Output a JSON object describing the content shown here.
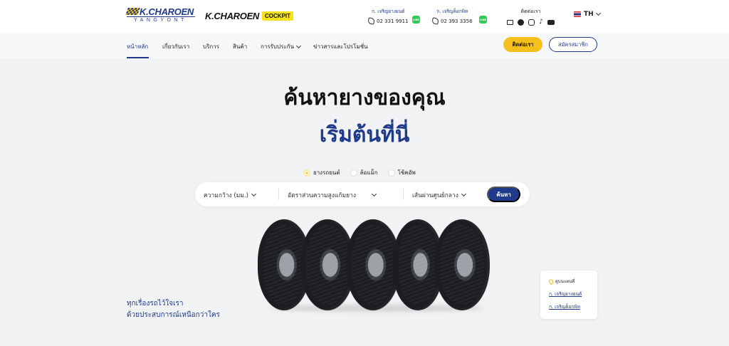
{
  "brand": {
    "logo_main": "K.CHAROEN",
    "logo_sub": "YANGYONT",
    "logo_second": "K.CHAROEN",
    "logo_second_badge": "COCKPIT"
  },
  "contacts": [
    {
      "label": "ก. เจริญยางยนต์",
      "phone": "02 331 9911"
    },
    {
      "label": "ก. เจริญค็อกพิท",
      "phone": "02 393 3356"
    }
  ],
  "social": {
    "label": "ติดต่อเรา"
  },
  "lang": {
    "current": "TH"
  },
  "nav": {
    "items": [
      "หน้าหลัก",
      "เกี่ยวกับเรา",
      "บริการ",
      "สินค้า",
      "การรับประกัน",
      "ข่าวสารและโปรโมชั่น"
    ],
    "contact_btn": "ติดต่อเรา",
    "member_btn": "สมัครสมาชิก"
  },
  "hero": {
    "title_line1": "ค้นหายางของคุณ",
    "title_line2": "เริ่มต้นที่นี่",
    "radios": [
      "ยางรถยนต์",
      "ล้อแม็ก",
      "โช้คอัพ"
    ],
    "selects": [
      "ความกว้าง (มม.)",
      "อัตราส่วนความสูงแก้มยาง",
      "เส้นผ่านศูนย์กลาง"
    ],
    "search_btn": "ค้นหา",
    "tagline_1": "ทุกเรื่องรถไว้ใจเรา",
    "tagline_2": "ด้วยประสบการณ์เหนือกว่าใคร"
  },
  "map_card": {
    "title": "ดูบนแผนที่",
    "links": [
      "ก. เจริญยางยนต์",
      "ก. เจริญค็อกพิท"
    ]
  },
  "colors": {
    "brand_blue": "#1f3a8a",
    "accent_yellow": "#f5bf1c",
    "line_green": "#2fcb55"
  }
}
